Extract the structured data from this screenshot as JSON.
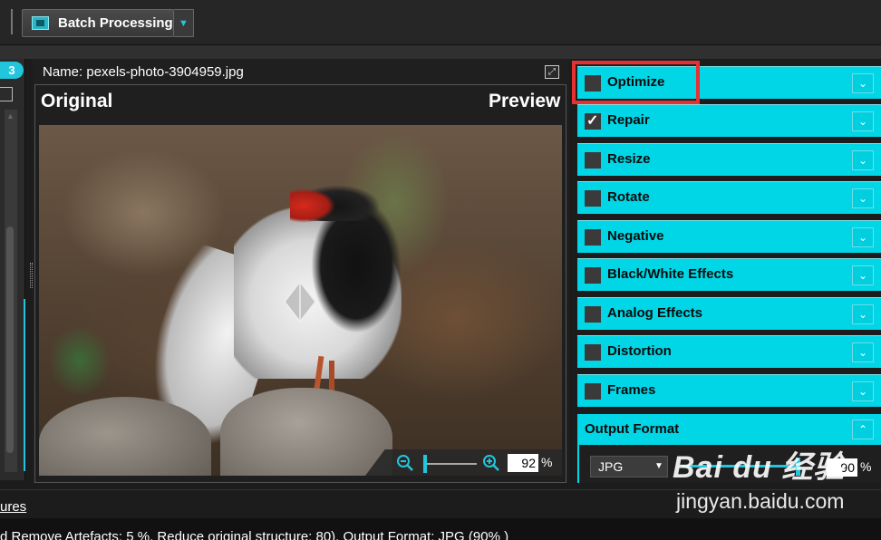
{
  "toolbar": {
    "batch_label": "Batch Processing"
  },
  "left": {
    "count": "3"
  },
  "preview": {
    "name_label": "Name: pexels-photo-3904959.jpg",
    "original_label": "Original",
    "preview_label": "Preview",
    "zoom_value": "92",
    "zoom_unit": "%"
  },
  "sections": [
    {
      "label": "Optimize",
      "checked": false
    },
    {
      "label": "Repair",
      "checked": true
    },
    {
      "label": "Resize",
      "checked": false
    },
    {
      "label": "Rotate",
      "checked": false
    },
    {
      "label": "Negative",
      "checked": false
    },
    {
      "label": "Black/White Effects",
      "checked": false
    },
    {
      "label": "Analog Effects",
      "checked": false
    },
    {
      "label": "Distortion",
      "checked": false
    },
    {
      "label": "Frames",
      "checked": false
    }
  ],
  "output": {
    "header": "Output Format",
    "format": "JPG",
    "quality": "90",
    "quality_unit": "%",
    "quality_fraction": 0.9
  },
  "bottom": {
    "link": "ures",
    "status": "d Remove Artefacts: 5 %, Reduce original structure: 80), Output Format: JPG (90% )"
  },
  "watermark": {
    "logo": "Bai du 经验",
    "url": "jingyan.baidu.com"
  },
  "colors": {
    "accent": "#00d6e6",
    "highlight": "#e53131"
  }
}
